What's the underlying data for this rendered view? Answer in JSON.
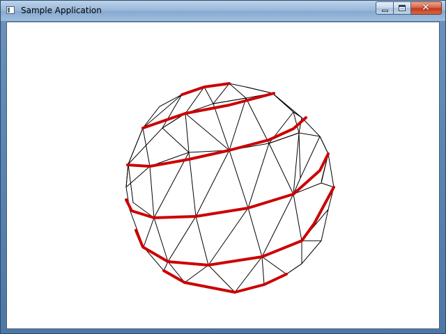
{
  "window": {
    "title": "Sample Application",
    "icon": "application-window-icon"
  },
  "caption_buttons": {
    "minimize": "minimize-icon",
    "maximize": "maximize-icon",
    "close": "close-icon",
    "close_glyph": "✕"
  },
  "scene": {
    "object": "wireframe-sphere",
    "colors": {
      "background": "#ffffff",
      "wireframe": "#000000",
      "latitude_bands": "#cc0000"
    }
  }
}
